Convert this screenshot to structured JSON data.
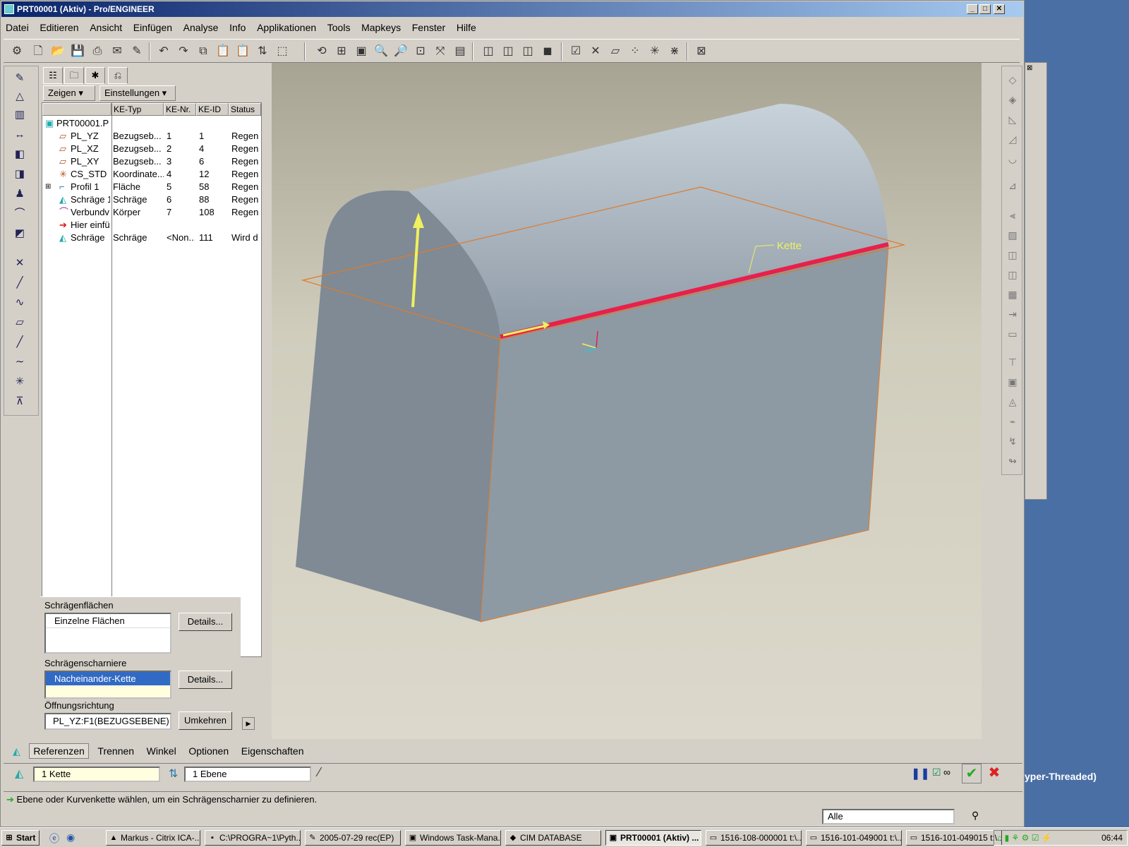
{
  "window": {
    "title": "PRT00001 (Aktiv) - Pro/ENGINEER",
    "min": "_",
    "max": "□",
    "close": "✕"
  },
  "menu": [
    "Datei",
    "Editieren",
    "Ansicht",
    "Einfügen",
    "Analyse",
    "Info",
    "Applikationen",
    "Tools",
    "Mapkeys",
    "Fenster",
    "Hilfe"
  ],
  "nav": {
    "show_label": "Zeigen ▾",
    "settings_label": "Einstellungen ▾",
    "columns": [
      "KE-Typ",
      "KE-Nr.",
      "KE-ID",
      "Status"
    ],
    "root": "PRT00001.P",
    "rows": [
      {
        "name": "PL_YZ",
        "type": "Bezugseb...",
        "nr": "1",
        "id": "1",
        "status": "Regen"
      },
      {
        "name": "PL_XZ",
        "type": "Bezugseb...",
        "nr": "2",
        "id": "4",
        "status": "Regen"
      },
      {
        "name": "PL_XY",
        "type": "Bezugseb...",
        "nr": "3",
        "id": "6",
        "status": "Regen"
      },
      {
        "name": "CS_STD",
        "type": "Koordinate...",
        "nr": "4",
        "id": "12",
        "status": "Regen"
      },
      {
        "name": "Profil 1",
        "type": "Fläche",
        "nr": "5",
        "id": "58",
        "status": "Regen"
      },
      {
        "name": "Schräge 1",
        "type": "Schräge",
        "nr": "6",
        "id": "88",
        "status": "Regen"
      },
      {
        "name": "Verbundv",
        "type": "Körper",
        "nr": "7",
        "id": "108",
        "status": "Regen"
      },
      {
        "name": "Hier einfü",
        "type": "",
        "nr": "",
        "id": "",
        "status": ""
      },
      {
        "name": "Schräge",
        "type": "Schräge",
        "nr": "<Non...",
        "id": "111",
        "status": "Wird d"
      }
    ]
  },
  "draft": {
    "surfaces_label": "Schrägenflächen",
    "surfaces_value": "Einzelne Flächen",
    "hinges_label": "Schrägenscharniere",
    "hinges_value": "Nacheinander-Kette",
    "direction_label": "Öffnungsrichtung",
    "direction_value": "PL_YZ:F1(BEZUGSEBENE)",
    "details": "Details...",
    "flip": "Umkehren"
  },
  "viewport": {
    "chain_label": "Kette"
  },
  "tabs": [
    "Referenzen",
    "Trennen",
    "Winkel",
    "Optionen",
    "Eigenschaften"
  ],
  "inputs": {
    "chain": "1 Kette",
    "plane": "1 Ebene"
  },
  "status_message": "Ebene oder Kurvenkette wählen, um ein Schrägenscharnier zu definieren.",
  "filter": "Alle",
  "bg_text": "yper-Threaded)",
  "taskbar": {
    "start": "Start",
    "tasks": [
      "Markus - Citrix ICA-...",
      "C:\\PROGRA~1\\Pyth...",
      "2005-07-29 rec(EP)",
      "Windows Task-Mana...",
      "CIM DATABASE",
      "PRT00001 (Aktiv) ...",
      "1516-108-000001 t:\\...",
      "1516-101-049001 t:\\...",
      "1516-101-049015 t:\\..."
    ],
    "clock": "06:44"
  },
  "colors": {
    "accent": "#0a246a",
    "chain": "#e8204a",
    "arrow": "#f0f060",
    "outline": "#e07a2a"
  }
}
